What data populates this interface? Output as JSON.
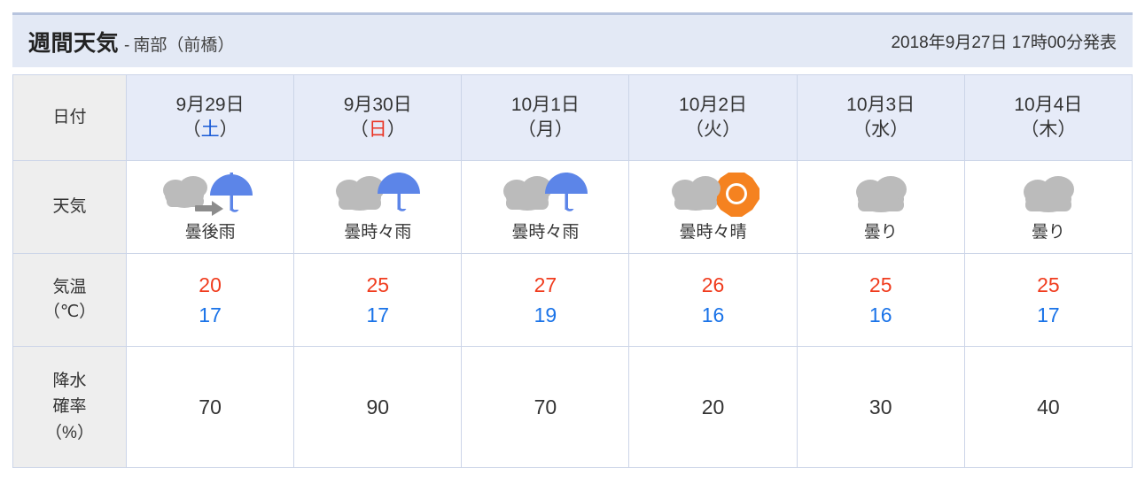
{
  "header": {
    "title": "週間天気",
    "separator": "-",
    "area": "南部（前橋）",
    "announced": "2018年9月27日 17時00分発表"
  },
  "table": {
    "row_labels": {
      "date": "日付",
      "weather": "天気",
      "temperature_line1": "気温",
      "temperature_line2": "（℃）",
      "precipitation_line1": "降水",
      "precipitation_line2": "確率",
      "precipitation_line3": "（%）"
    },
    "days": [
      {
        "date": "9月29日",
        "dow": "土",
        "dow_type": "sat",
        "weather_text": "曇後雨",
        "weather_icon": "cloud-arrow-umbrella-icon",
        "temp_high": "20",
        "temp_low": "17",
        "pop": "70"
      },
      {
        "date": "9月30日",
        "dow": "日",
        "dow_type": "sun",
        "weather_text": "曇時々雨",
        "weather_icon": "cloud-umbrella-icon",
        "temp_high": "25",
        "temp_low": "17",
        "pop": "90"
      },
      {
        "date": "10月1日",
        "dow": "月",
        "dow_type": "normal",
        "weather_text": "曇時々雨",
        "weather_icon": "cloud-umbrella-icon",
        "temp_high": "27",
        "temp_low": "19",
        "pop": "70"
      },
      {
        "date": "10月2日",
        "dow": "火",
        "dow_type": "normal",
        "weather_text": "曇時々晴",
        "weather_icon": "cloud-sun-icon",
        "temp_high": "26",
        "temp_low": "16",
        "pop": "20"
      },
      {
        "date": "10月3日",
        "dow": "水",
        "dow_type": "normal",
        "weather_text": "曇り",
        "weather_icon": "cloud-icon",
        "temp_high": "25",
        "temp_low": "16",
        "pop": "30"
      },
      {
        "date": "10月4日",
        "dow": "木",
        "dow_type": "normal",
        "weather_text": "曇り",
        "weather_icon": "cloud-icon",
        "temp_high": "25",
        "temp_low": "17",
        "pop": "40"
      }
    ]
  },
  "colors": {
    "header_bg": "#e3e9f5",
    "header_top_border": "#b7c4de",
    "date_cell_bg": "#e6ebf8",
    "row_label_bg": "#eeeeee",
    "border": "#ccd5e8",
    "cloud_gray": "#bbbbbb",
    "umbrella_blue": "#5c85e8",
    "sun_orange": "#f58220",
    "temp_high_red": "#f03c1e",
    "temp_low_blue": "#1a73e8",
    "saturday_blue": "#1558d6",
    "sunday_red": "#ea3323"
  }
}
